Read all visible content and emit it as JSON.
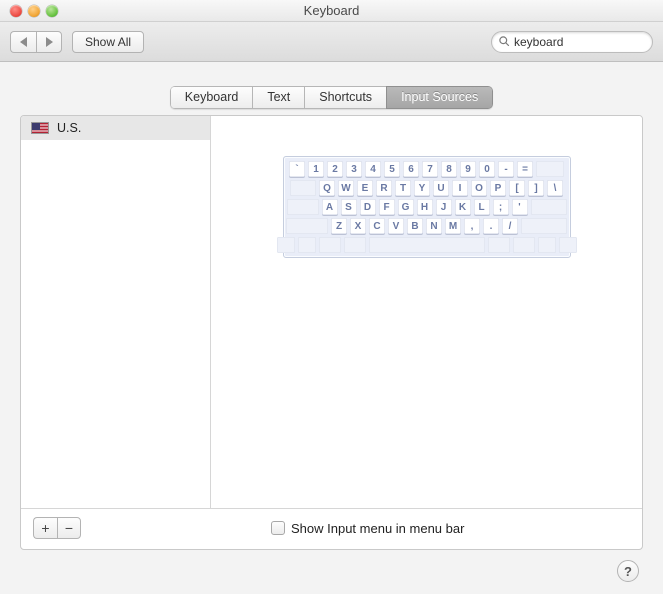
{
  "window": {
    "title": "Keyboard"
  },
  "toolbar": {
    "show_all_label": "Show All",
    "search_value": "keyboard"
  },
  "tabs": [
    {
      "label": "Keyboard"
    },
    {
      "label": "Text"
    },
    {
      "label": "Shortcuts"
    },
    {
      "label": "Input Sources"
    }
  ],
  "active_tab_index": 3,
  "sources": [
    {
      "name": "U.S.",
      "flag": "us"
    }
  ],
  "keyboard_rows": [
    [
      "`",
      "1",
      "2",
      "3",
      "4",
      "5",
      "6",
      "7",
      "8",
      "9",
      "0",
      "-",
      "="
    ],
    [
      "Q",
      "W",
      "E",
      "R",
      "T",
      "Y",
      "U",
      "I",
      "O",
      "P",
      "[",
      "]",
      "\\"
    ],
    [
      "A",
      "S",
      "D",
      "F",
      "G",
      "H",
      "J",
      "K",
      "L",
      ";",
      "'"
    ],
    [
      "Z",
      "X",
      "C",
      "V",
      "B",
      "N",
      "M",
      ",",
      ".",
      "/"
    ]
  ],
  "footer": {
    "add_icon": "+",
    "remove_icon": "−",
    "checkbox_label": "Show Input menu in menu bar",
    "checkbox_checked": false,
    "help_icon": "?"
  }
}
